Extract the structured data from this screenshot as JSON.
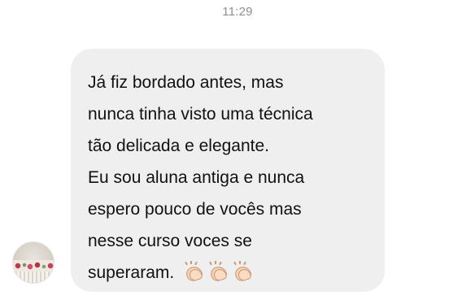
{
  "header": {
    "time": "11:29"
  },
  "message": {
    "lines": [
      "Já fiz bordado antes, mas",
      "nunca tinha visto uma técnica",
      "tão delicada e elegante.",
      "Eu sou aluna antiga e nunca",
      "espero pouco de vocês mas",
      "nesse curso voces se",
      "superaram."
    ],
    "emoji": [
      "clapping-hands",
      "clapping-hands",
      "clapping-hands"
    ]
  },
  "colors": {
    "bubble": "#efeff0",
    "text": "#111111",
    "timestamp": "#8e8e93"
  }
}
